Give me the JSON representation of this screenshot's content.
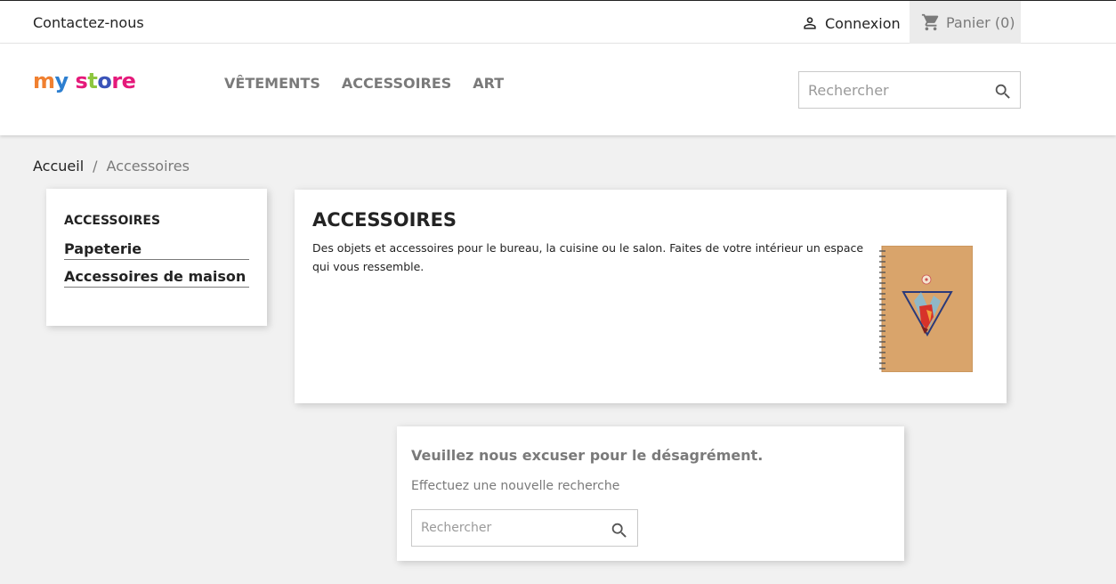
{
  "topbar": {
    "contact_label": "Contactez-nous",
    "login_label": "Connexion",
    "cart_label": "Panier (0)"
  },
  "header": {
    "logo_text": "my store",
    "menu": [
      "VÊTEMENTS",
      "ACCESSOIRES",
      "ART"
    ],
    "search_placeholder": "Rechercher"
  },
  "breadcrumb": {
    "home": "Accueil",
    "separator": "/",
    "current": "Accessoires"
  },
  "sidebar": {
    "title": "ACCESSOIRES",
    "items": [
      "Papeterie",
      "Accessoires de maison"
    ]
  },
  "category": {
    "title": "ACCESSOIRES",
    "description": "Des objets et accessoires pour le bureau, la cuisine ou le salon. Faites de votre intérieur un espace qui vous ressemble."
  },
  "not_found": {
    "heading": "Veuillez nous excuser pour le désagrément.",
    "text": "Effectuez une nouvelle recherche",
    "search_placeholder": "Rechercher"
  },
  "colors": {
    "accent_grey": "#7a7a7a",
    "text_dark": "#232323",
    "page_bg": "#f1f1f1",
    "cart_bg": "#ebebeb"
  },
  "icons": {
    "login": "person-icon",
    "cart": "cart-icon",
    "search": "search-icon"
  }
}
